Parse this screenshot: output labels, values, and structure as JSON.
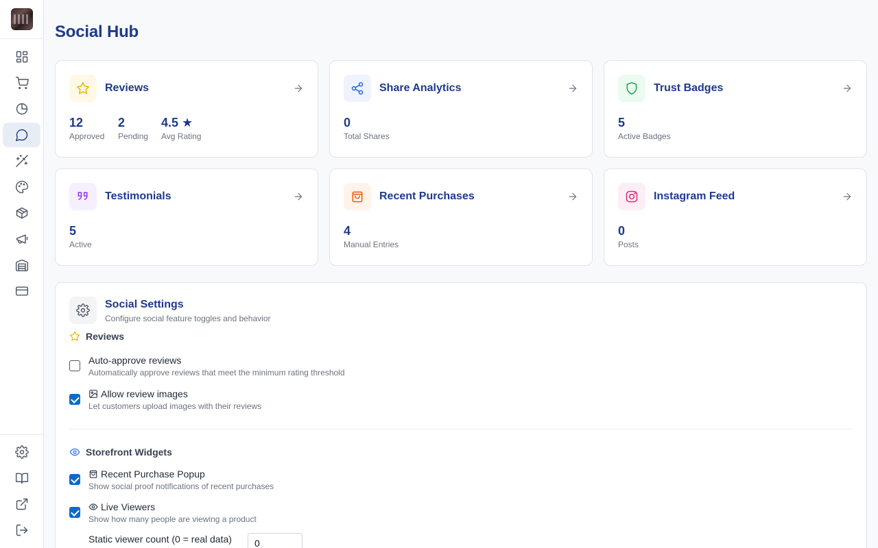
{
  "page": {
    "title": "Social Hub"
  },
  "sidebar": {
    "items": [
      {
        "icon": "dashboard-icon"
      },
      {
        "icon": "cart-icon"
      },
      {
        "icon": "pie-chart-icon"
      },
      {
        "icon": "chat-bubble-icon",
        "active": true
      },
      {
        "icon": "magic-wand-icon"
      },
      {
        "icon": "palette-icon"
      },
      {
        "icon": "package-icon"
      },
      {
        "icon": "megaphone-icon"
      },
      {
        "icon": "warehouse-icon"
      },
      {
        "icon": "credit-card-icon"
      }
    ],
    "bottom": [
      {
        "icon": "settings-icon"
      },
      {
        "icon": "book-icon"
      },
      {
        "icon": "external-link-icon"
      },
      {
        "icon": "logout-icon"
      }
    ]
  },
  "cards": {
    "reviews": {
      "title": "Reviews",
      "icon": "star-icon",
      "color": "#eab308",
      "bg": "#fef9e7",
      "stats": {
        "approved": {
          "value": "12",
          "label": "Approved"
        },
        "pending": {
          "value": "2",
          "label": "Pending"
        },
        "avg": {
          "value": "4.5 ★",
          "label": "Avg Rating"
        }
      }
    },
    "share": {
      "title": "Share Analytics",
      "icon": "share-icon",
      "color": "#2563eb",
      "bg": "#eef3fe",
      "stats": {
        "total": {
          "value": "0",
          "label": "Total Shares"
        }
      }
    },
    "trust": {
      "title": "Trust Badges",
      "icon": "shield-icon",
      "color": "#16a34a",
      "bg": "#ecfbf1",
      "stats": {
        "active": {
          "value": "5",
          "label": "Active Badges"
        }
      }
    },
    "testimonials": {
      "title": "Testimonials",
      "icon": "quote-icon",
      "color": "#9333ea",
      "bg": "#f6effe",
      "stats": {
        "active": {
          "value": "5",
          "label": "Active"
        }
      }
    },
    "purchases": {
      "title": "Recent Purchases",
      "icon": "shopping-bag-icon",
      "color": "#ea580c",
      "bg": "#fff3ea",
      "stats": {
        "manual": {
          "value": "4",
          "label": "Manual Entries"
        }
      }
    },
    "instagram": {
      "title": "Instagram Feed",
      "icon": "instagram-icon",
      "color": "#db2777",
      "bg": "#fdeef5",
      "stats": {
        "posts": {
          "value": "0",
          "label": "Posts"
        }
      }
    }
  },
  "settings": {
    "title": "Social Settings",
    "subtitle": "Configure social feature toggles and behavior",
    "reviews_section": {
      "title": "Reviews",
      "auto_approve": {
        "label": "Auto-approve reviews",
        "desc": "Automatically approve reviews that meet the minimum rating threshold",
        "checked": false
      },
      "allow_images": {
        "label": "Allow review images",
        "desc": "Let customers upload images with their reviews",
        "checked": true
      }
    },
    "widgets_section": {
      "title": "Storefront Widgets",
      "purchase_popup": {
        "label": "Recent Purchase Popup",
        "desc": "Show social proof notifications of recent purchases",
        "checked": true
      },
      "live_viewers": {
        "label": "Live Viewers",
        "desc": "Show how many people are viewing a product",
        "checked": true
      },
      "static_count": {
        "label": "Static viewer count (0 = real data)",
        "value": "0"
      }
    }
  }
}
